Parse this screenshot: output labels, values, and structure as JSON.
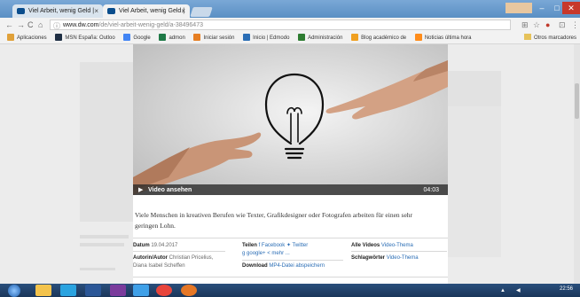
{
  "browser": {
    "tabs": [
      {
        "label": "Viel Arbeit, wenig Geld | ",
        "active": false
      },
      {
        "label": "Viel Arbeit, wenig Geld | ",
        "active": true
      }
    ],
    "address": {
      "host": "www.dw.com",
      "path": "/de/viel-arbeit-wenig-geld/a-38496473"
    },
    "bookmarks": [
      {
        "label": "Aplicaciones",
        "icon": "apps-icon",
        "color": "#e0a13a"
      },
      {
        "label": "MSN España: Outloo",
        "icon": "msn-icon",
        "color": "#1f2f44"
      },
      {
        "label": "Google",
        "icon": "google-icon",
        "color": "#4285f4"
      },
      {
        "label": "admon",
        "icon": "excel-icon",
        "color": "#1f7a47"
      },
      {
        "label": "Iniciar sesión",
        "icon": "office-icon",
        "color": "#e67e22"
      },
      {
        "label": "Inicio | Edmodo",
        "icon": "edmodo-icon",
        "color": "#2a6db5"
      },
      {
        "label": "Administración",
        "icon": "admin-icon",
        "color": "#2e7d32"
      },
      {
        "label": "Blog académico de",
        "icon": "blog-icon",
        "color": "#f0a020"
      },
      {
        "label": "Noticias última hora",
        "icon": "news-icon",
        "color": "#ff8c1a"
      }
    ],
    "other_bookmarks": "Otros marcadores"
  },
  "video": {
    "play_label": "Video ansehen",
    "duration": "04:03"
  },
  "article": {
    "caption": "Viele Menschen in kreativen Berufen wie Texter, Grafikdesigner oder Fotografen arbeiten für einen sehr geringen Lohn."
  },
  "meta": {
    "date_label": "Datum",
    "date_value": "19.04.2017",
    "author_label": "Autorin/Autor",
    "author_value": "Christian Pricelius, Diana Isabel Scheffen",
    "share_label": "Teilen",
    "share_facebook": "Facebook",
    "share_twitter": "Twitter",
    "share_google": "google+",
    "share_more": "mehr ...",
    "download_label": "Download",
    "download_value": "MP4-Datei abspeichern",
    "allvideos_label": "Alle Videos",
    "allvideos_value": "Video-Thema",
    "keywords_label": "Schlagwörter",
    "keywords_value": "Video-Thema"
  },
  "taskbar": {
    "time": "22:56",
    "apps": [
      {
        "icon": "explorer-icon",
        "color": "#f3c34c"
      },
      {
        "icon": "skype-icon",
        "color": "#2aa3e0"
      },
      {
        "icon": "word-icon",
        "color": "#2b5797"
      },
      {
        "icon": "onenote-icon",
        "color": "#7a3b9c"
      },
      {
        "icon": "ie-icon",
        "color": "#3fa0e8"
      },
      {
        "icon": "chrome-icon",
        "color": "#e8453c"
      },
      {
        "icon": "firefox-icon",
        "color": "#e57726"
      }
    ]
  }
}
